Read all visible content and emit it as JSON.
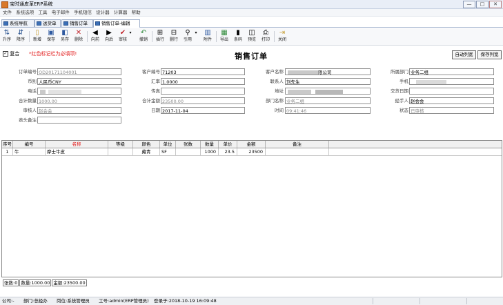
{
  "window": {
    "title": "宝时通皮革ERP系统",
    "minimize": "—",
    "maximize": "□",
    "close": "✕"
  },
  "menu": [
    "文件",
    "系统选项",
    "工具",
    "电子邮件",
    "手机短信",
    "设计器",
    "计算器",
    "帮助"
  ],
  "tabs": [
    "系统导航",
    "送货单",
    "销售订单",
    "销售订单-编辑"
  ],
  "toolbar": [
    {
      "label": "升序",
      "icon": "sort-asc-icon",
      "glyph": "⇅",
      "color": "#1f4b8a"
    },
    {
      "label": "降序",
      "icon": "sort-desc-icon",
      "glyph": "⇵",
      "color": "#1f4b8a"
    },
    {
      "label": "新增",
      "icon": "new-doc-icon",
      "glyph": "▯",
      "color": "#c9a13b"
    },
    {
      "label": "保存",
      "icon": "save-icon",
      "glyph": "▣",
      "color": "#2f5aa0"
    },
    {
      "label": "另存",
      "icon": "save-as-icon",
      "glyph": "◧",
      "color": "#2f5aa0"
    },
    {
      "label": "删除",
      "icon": "delete-icon",
      "glyph": "✕",
      "color": "#c1272d"
    },
    {
      "label": "向前",
      "icon": "prev-icon",
      "glyph": "◀",
      "color": "#222"
    },
    {
      "label": "向后",
      "icon": "next-icon",
      "glyph": "▶",
      "color": "#222"
    },
    {
      "label": "审核",
      "icon": "approve-icon",
      "glyph": "✔",
      "color": "#c1272d"
    },
    {
      "label": "撤销",
      "icon": "undo-icon",
      "glyph": "↶",
      "color": "#2f8a3a"
    },
    {
      "label": "插行",
      "icon": "insert-row-icon",
      "glyph": "⊞",
      "color": "#333"
    },
    {
      "label": "删行",
      "icon": "delete-row-icon",
      "glyph": "⊟",
      "color": "#333"
    },
    {
      "label": "引用",
      "icon": "reference-icon",
      "glyph": "⚲",
      "color": "#333"
    },
    {
      "label": "附件",
      "icon": "attachment-icon",
      "glyph": "▥",
      "color": "#2f5aa0"
    },
    {
      "label": "导出",
      "icon": "export-icon",
      "glyph": "▦",
      "color": "#2f8a3a"
    },
    {
      "label": "条码",
      "icon": "barcode-icon",
      "glyph": "▮",
      "color": "#333"
    },
    {
      "label": "预览",
      "icon": "preview-icon",
      "glyph": "◫",
      "color": "#333"
    },
    {
      "label": "打印",
      "icon": "print-icon",
      "glyph": "⎙",
      "color": "#333"
    },
    {
      "label": "关闭",
      "icon": "close-doc-icon",
      "glyph": "⇥",
      "color": "#c9a13b"
    }
  ],
  "header": {
    "checkbox_label": "复合",
    "hint": "*红色标记栏为必填项!",
    "title": "销售订单",
    "auto_col_btn": "自动列宽",
    "save_col_btn": "保存列宽"
  },
  "form": {
    "order_no": {
      "label": "订单编号",
      "value": "OD20171104001"
    },
    "currency": {
      "label": "币别",
      "value": "人民币CNY"
    },
    "phone": {
      "label": "电话",
      "value": ""
    },
    "total_qty": {
      "label": "合计数量",
      "value": "1000.00"
    },
    "reviewer": {
      "label": "审核人",
      "value": "赵会会"
    },
    "remark": {
      "label": "表头备注",
      "value": ""
    },
    "customer_no": {
      "label": "客户编号",
      "value": "71203"
    },
    "rate": {
      "label": "汇率",
      "value": "1.0000"
    },
    "fax": {
      "label": "传真",
      "value": ""
    },
    "total_amount": {
      "label": "合计金额",
      "value": "23500.00"
    },
    "date": {
      "label": "日期",
      "value": "2017-11-04"
    },
    "customer_name": {
      "label": "客户名称",
      "value": "限公司"
    },
    "contact": {
      "label": "联系人",
      "value": "刘先生"
    },
    "address": {
      "label": "地址",
      "value": ""
    },
    "dept_name": {
      "label": "部门名称",
      "value": "业务二组"
    },
    "time": {
      "label": "时间",
      "value": "09:41:46"
    },
    "dept": {
      "label": "所属部门",
      "value": "业务二组"
    },
    "mobile": {
      "label": "手机",
      "value": ""
    },
    "delivery_date": {
      "label": "交货日期",
      "value": ""
    },
    "handler": {
      "label": "经手人",
      "value": "赵会会"
    },
    "status": {
      "label": "状态",
      "value": "已审核"
    }
  },
  "grid": {
    "columns": [
      "序号",
      "编号",
      "名称",
      "等级",
      "颜色",
      "单位",
      "张数",
      "数量",
      "单价",
      "金额",
      "备注"
    ],
    "rows": [
      [
        "1",
        "牛",
        "摩士牛皮",
        "",
        "藏青",
        "SF",
        "",
        "1000",
        "23.5",
        "23500",
        ""
      ]
    ]
  },
  "totals": {
    "rows": "张数:0",
    "qty": "数量:1000.00",
    "amount": "金额:23500.00"
  },
  "status": {
    "company": "公司:-",
    "dept": "部门:总经办",
    "position": "岗位:系统管理员",
    "user": "工号:admin(ERP管理员)",
    "login": "登录于:2018-10-19 16:09:48"
  }
}
